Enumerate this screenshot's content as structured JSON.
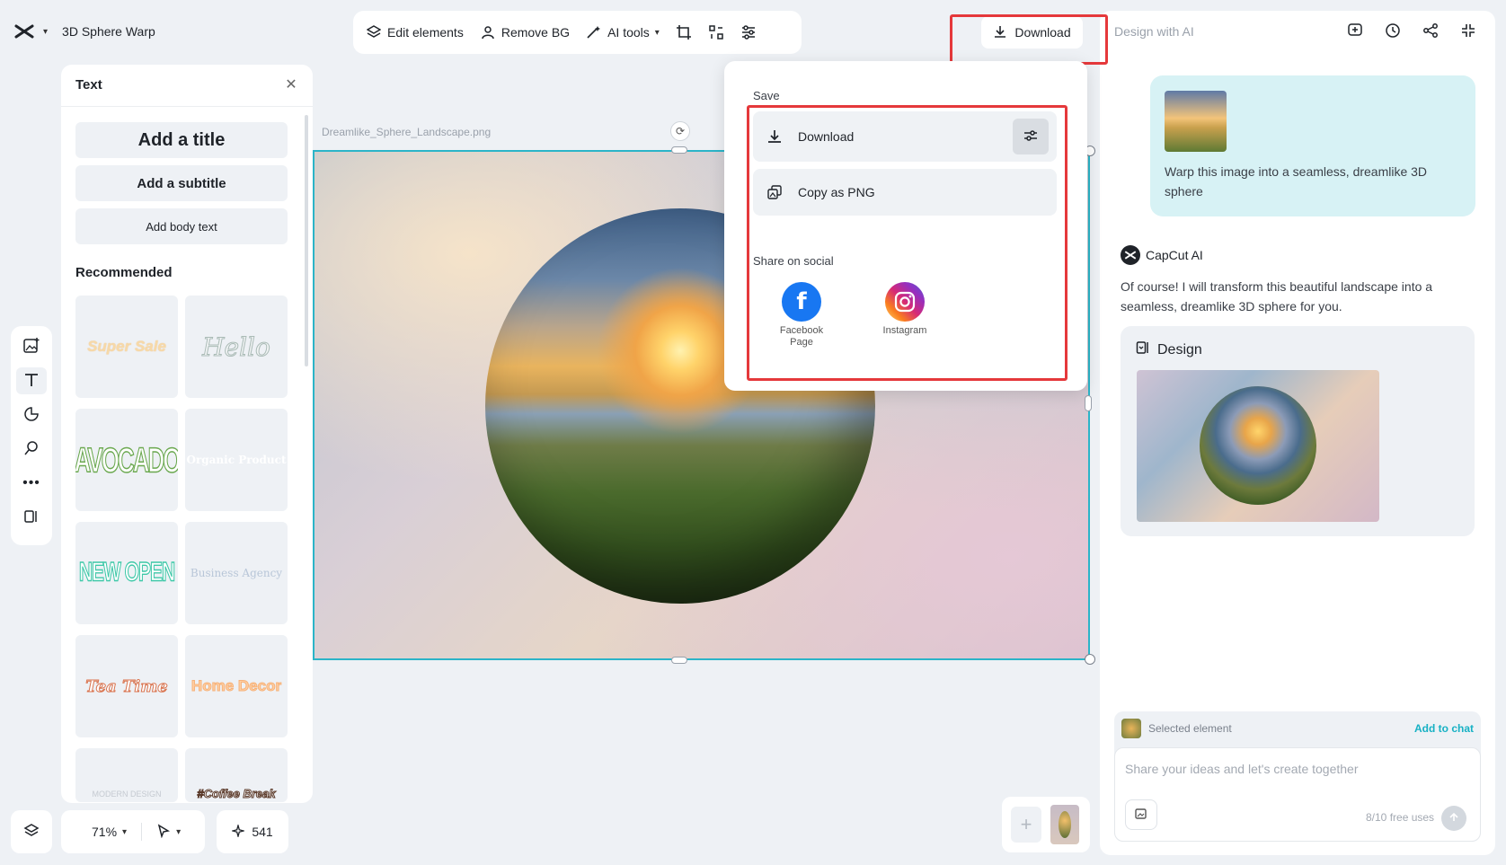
{
  "header": {
    "project_title": "3D Sphere Warp"
  },
  "toolbar": {
    "edit_elements": "Edit elements",
    "remove_bg": "Remove BG",
    "ai_tools": "AI tools"
  },
  "download_button": {
    "label": "Download"
  },
  "right_panel": {
    "tab_label": "Design with AI",
    "user_message": "Warp this image into a seamless, dreamlike 3D sphere",
    "ai_name": "CapCut AI",
    "ai_reply": "Of course! I will transform this beautiful landscape into a seamless, dreamlike 3D sphere for you.",
    "design_label": "Design",
    "selected_element": "Selected element",
    "add_to_chat": "Add to chat",
    "input_placeholder": "Share your ideas and let's create together",
    "free_uses": "8/10 free uses"
  },
  "text_panel": {
    "title": "Text",
    "add_title": "Add a title",
    "add_subtitle": "Add a subtitle",
    "add_body": "Add body text",
    "recommended": "Recommended",
    "tiles": [
      {
        "text": "Super Sale",
        "color": "#f7d9a8"
      },
      {
        "text": "Hello",
        "color": "#c9d6d2"
      },
      {
        "text": "AVOCADO",
        "color": "#6aa84f"
      },
      {
        "text": "Organic Product",
        "color": "#d8dde3"
      },
      {
        "text": "NEW OPEN",
        "color": "#3ec8a8"
      },
      {
        "text": "Business Agency",
        "color": "#b8c6d8"
      },
      {
        "text": "Tea Time",
        "color": "#d9744f"
      },
      {
        "text": "Home Decor",
        "color": "#f6b27a"
      },
      {
        "text": "MODERN DESIGN",
        "color": "#c5cad1"
      },
      {
        "text": "#Coffee Break",
        "color": "#5b3a2a"
      }
    ]
  },
  "canvas": {
    "file_name": "Dreamlike_Sphere_Landscape.png"
  },
  "dropdown": {
    "save_label": "Save",
    "download_label": "Download",
    "copy_png_label": "Copy as PNG",
    "share_label": "Share on social",
    "facebook_label": "Facebook Page",
    "instagram_label": "Instagram"
  },
  "bottom_bar": {
    "zoom": "71%",
    "credits": "541"
  },
  "colors": {
    "accent": "#17b1c4",
    "highlight": "#e5383b",
    "facebook": "#1877f2"
  }
}
